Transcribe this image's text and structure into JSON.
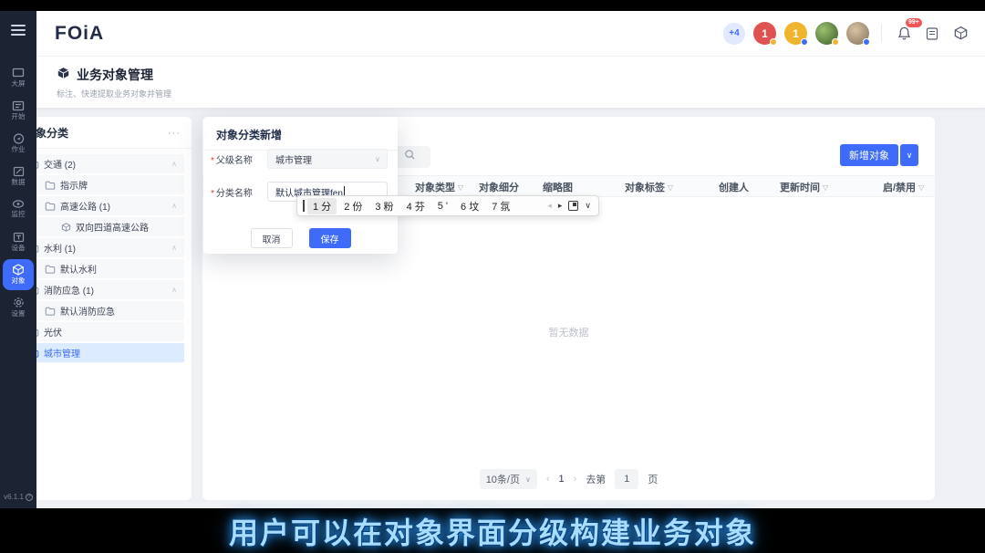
{
  "header": {
    "logo": "FOiA",
    "overflow_badge": "+4",
    "avatar1_label": "1",
    "avatar2_label": "1",
    "bell_badge": "99+"
  },
  "sidebar": {
    "items": [
      {
        "label": "大屏"
      },
      {
        "label": "开始"
      },
      {
        "label": "作业"
      },
      {
        "label": "数据"
      },
      {
        "label": "监控"
      },
      {
        "label": "设备"
      },
      {
        "label": "对象",
        "active": true
      },
      {
        "label": "设置"
      }
    ],
    "version": "v6.1.1"
  },
  "page": {
    "title": "业务对象管理",
    "subtitle": "标注、快速提取业务对象并管理"
  },
  "tree": {
    "title": "对象分类",
    "menu": "···",
    "items": [
      {
        "label": "交通 (2)",
        "level": 0,
        "expanded": true
      },
      {
        "label": "指示牌",
        "level": 1
      },
      {
        "label": "高速公路 (1)",
        "level": 1,
        "expanded": true
      },
      {
        "label": "双向四道高速公路",
        "level": 2,
        "icon": "object-cube"
      },
      {
        "label": "水利 (1)",
        "level": 0,
        "expanded": true
      },
      {
        "label": "默认水利",
        "level": 1
      },
      {
        "label": "消防应急 (1)",
        "level": 0,
        "expanded": true
      },
      {
        "label": "默认消防应急",
        "level": 1
      },
      {
        "label": "光伏",
        "level": 0
      },
      {
        "label": "城市管理",
        "level": 0,
        "selected": true
      }
    ]
  },
  "toolbar": {
    "add_label": "新增对象"
  },
  "table": {
    "columns": [
      {
        "label": "对象类型",
        "filter": true
      },
      {
        "label": "对象细分",
        "filter": false
      },
      {
        "label": "缩略图",
        "filter": false
      },
      {
        "label": "对象标签",
        "filter": true
      },
      {
        "label": "创建人",
        "filter": false
      },
      {
        "label": "更新时间",
        "filter": true
      },
      {
        "label": "启/禁用",
        "filter": true
      }
    ],
    "empty_text": "暂无数据"
  },
  "pagination": {
    "page_size": "10条/页",
    "prev": "‹",
    "current_page": "1",
    "next": "›",
    "goto_prefix": "去第",
    "goto_page": "1",
    "goto_suffix": "页"
  },
  "modal": {
    "title": "对象分类新增",
    "parent_label": "父级名称",
    "parent_value": "城市管理",
    "name_label": "分类名称",
    "name_value": "默认城市管理fen",
    "cancel_label": "取消",
    "save_label": "保存"
  },
  "ime": {
    "candidates": [
      "1 分",
      "2 份",
      "3 粉",
      "4 芬",
      "5 '",
      "6 坟",
      "7 氛"
    ]
  },
  "caption": {
    "text": "用户可以在对象界面分级构建业务对象"
  },
  "colors": {
    "accent": "#3f6bfa",
    "selected_bg": "#dcebfd",
    "sidebar_bg": "#1c2332"
  }
}
